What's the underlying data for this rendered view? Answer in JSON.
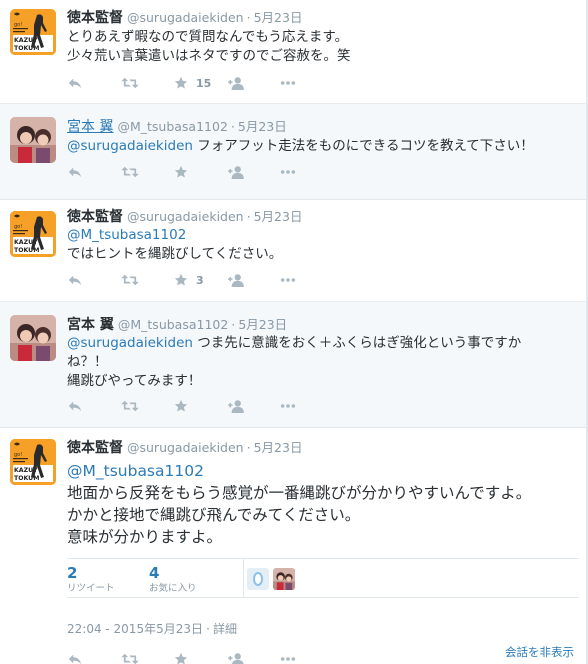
{
  "tweets": [
    {
      "name": "徳本監督",
      "handle": "@surugadaiekiden",
      "date": "5月23日",
      "lines": [
        "とりあえず暇なので質問なんでもう応えます。",
        "少々荒い言葉遣いはネタですのでご容赦を。笑"
      ],
      "favorites": "15"
    },
    {
      "name": "宮本 翼",
      "handle": "@M_tsubasa1102",
      "date": "5月23日",
      "mention": "@surugadaiekiden",
      "rest": " フォアフット走法をものにできるコツを教えて下さい！"
    },
    {
      "name": "徳本監督",
      "handle": "@surugadaiekiden",
      "date": "5月23日",
      "mention": "@M_tsubasa1102",
      "lines": [
        "ではヒントを縄跳びしてください。"
      ],
      "favorites": "3"
    },
    {
      "name": "宮本 翼",
      "handle": "@M_tsubasa1102",
      "date": "5月23日",
      "mention": "@surugadaiekiden",
      "rest": " つま先に意識をおく＋ふくらはぎ強化という事ですか",
      "lines": [
        "ね？！",
        "縄跳びやってみます！"
      ]
    },
    {
      "name": "徳本監督",
      "handle": "@surugadaiekiden",
      "date": "5月23日",
      "mention": "@M_tsubasa1102",
      "lines": [
        "地面から反発をもらう感覚が一番縄跳びが分かりやすいんですよ。",
        "かかと接地で縄跳び飛んでみてください。",
        "意味が分かりますよ。"
      ],
      "retweets": "2",
      "retweets_label": "リツイート",
      "favorites": "4",
      "favorites_label": "お気に入り",
      "timestamp": "22:04 - 2015年5月23日",
      "detail": "詳細",
      "hide_label": "会話を非表示"
    }
  ],
  "dot": "·",
  "icons": [
    "reply-icon",
    "retweet-icon",
    "favorite-icon",
    "follow-icon",
    "more-icon"
  ],
  "colors": {
    "accent": "#2b7bb9",
    "muted": "#8899a6",
    "icon": "#aab8c2",
    "avatar_orange": "#f6a027"
  }
}
